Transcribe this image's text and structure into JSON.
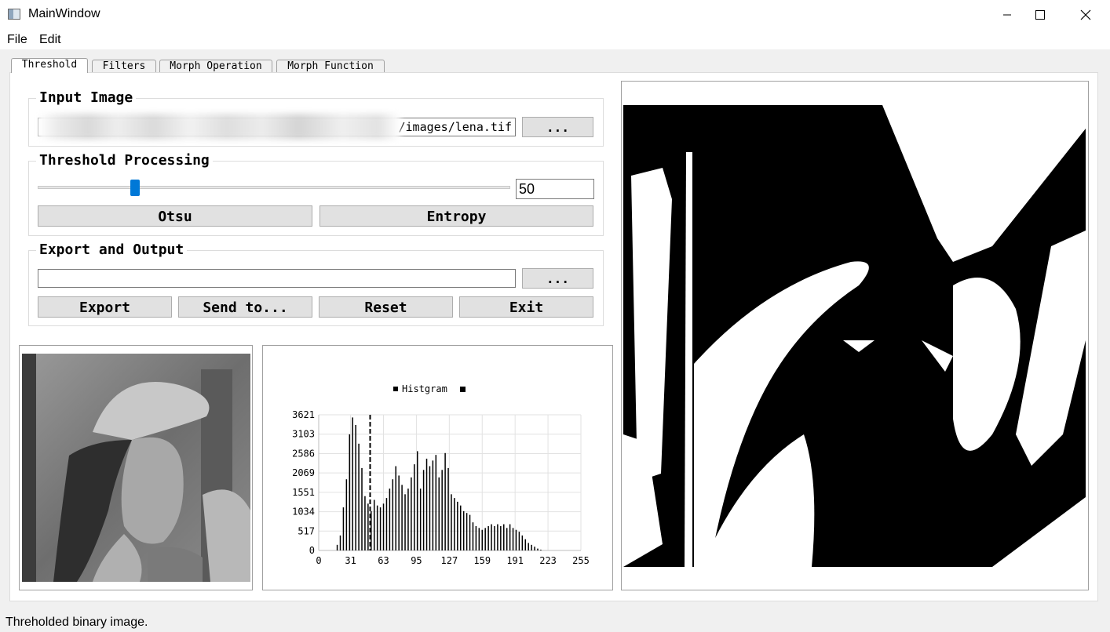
{
  "window": {
    "title": "MainWindow"
  },
  "menu": [
    "File",
    "Edit"
  ],
  "tabs": [
    "Threshold",
    "Filters",
    "Morph Operation",
    "Morph Function"
  ],
  "input_group": {
    "title": "Input Image",
    "path_visible": "/images/lena.tif",
    "browse_label": "..."
  },
  "threshold_group": {
    "title": "Threshold Processing",
    "slider_value_fraction": 0.2,
    "value": "50",
    "otsu_label": "Otsu",
    "entropy_label": "Entropy"
  },
  "export_group": {
    "title": "Export and Output",
    "output_path": "",
    "browse_label": "...",
    "export_label": "Export",
    "send_label": "Send to...",
    "reset_label": "Reset",
    "exit_label": "Exit"
  },
  "histogram": {
    "legend": "Histgram"
  },
  "chart_data": {
    "type": "bar",
    "title": "",
    "legend": [
      "Histgram"
    ],
    "xlabel": "",
    "ylabel": "",
    "xlim": [
      0,
      255
    ],
    "ylim": [
      0,
      3621
    ],
    "xticks": [
      "0",
      "31",
      "63",
      "95",
      "127",
      "159",
      "191",
      "223",
      "255"
    ],
    "yticks": [
      "0",
      "517",
      "1034",
      "1551",
      "2069",
      "2586",
      "3103",
      "3621"
    ],
    "threshold_line": 50,
    "x": [
      18,
      21,
      24,
      27,
      30,
      33,
      36,
      39,
      42,
      45,
      48,
      51,
      54,
      57,
      60,
      63,
      66,
      69,
      72,
      75,
      78,
      81,
      84,
      87,
      90,
      93,
      96,
      99,
      102,
      105,
      108,
      111,
      114,
      117,
      120,
      123,
      126,
      129,
      132,
      135,
      138,
      141,
      144,
      147,
      150,
      153,
      156,
      159,
      162,
      165,
      168,
      171,
      174,
      177,
      180,
      183,
      186,
      189,
      192,
      195,
      198,
      201,
      204,
      207,
      210,
      213,
      216
    ],
    "values": [
      150,
      400,
      1150,
      1900,
      3100,
      3550,
      3350,
      2850,
      2200,
      1450,
      1250,
      1050,
      1350,
      1200,
      1150,
      1250,
      1400,
      1650,
      1900,
      2250,
      2000,
      1750,
      1500,
      1650,
      1950,
      2300,
      2650,
      1650,
      2150,
      2450,
      2250,
      2400,
      2550,
      1950,
      2150,
      2600,
      2200,
      1500,
      1400,
      1300,
      1200,
      1050,
      1000,
      950,
      750,
      650,
      600,
      550,
      600,
      650,
      700,
      650,
      700,
      650,
      700,
      600,
      700,
      600,
      550,
      500,
      400,
      300,
      200,
      150,
      100,
      50,
      20
    ],
    "grid": true,
    "legend_position": "top-center"
  },
  "status": "Threholded binary image."
}
